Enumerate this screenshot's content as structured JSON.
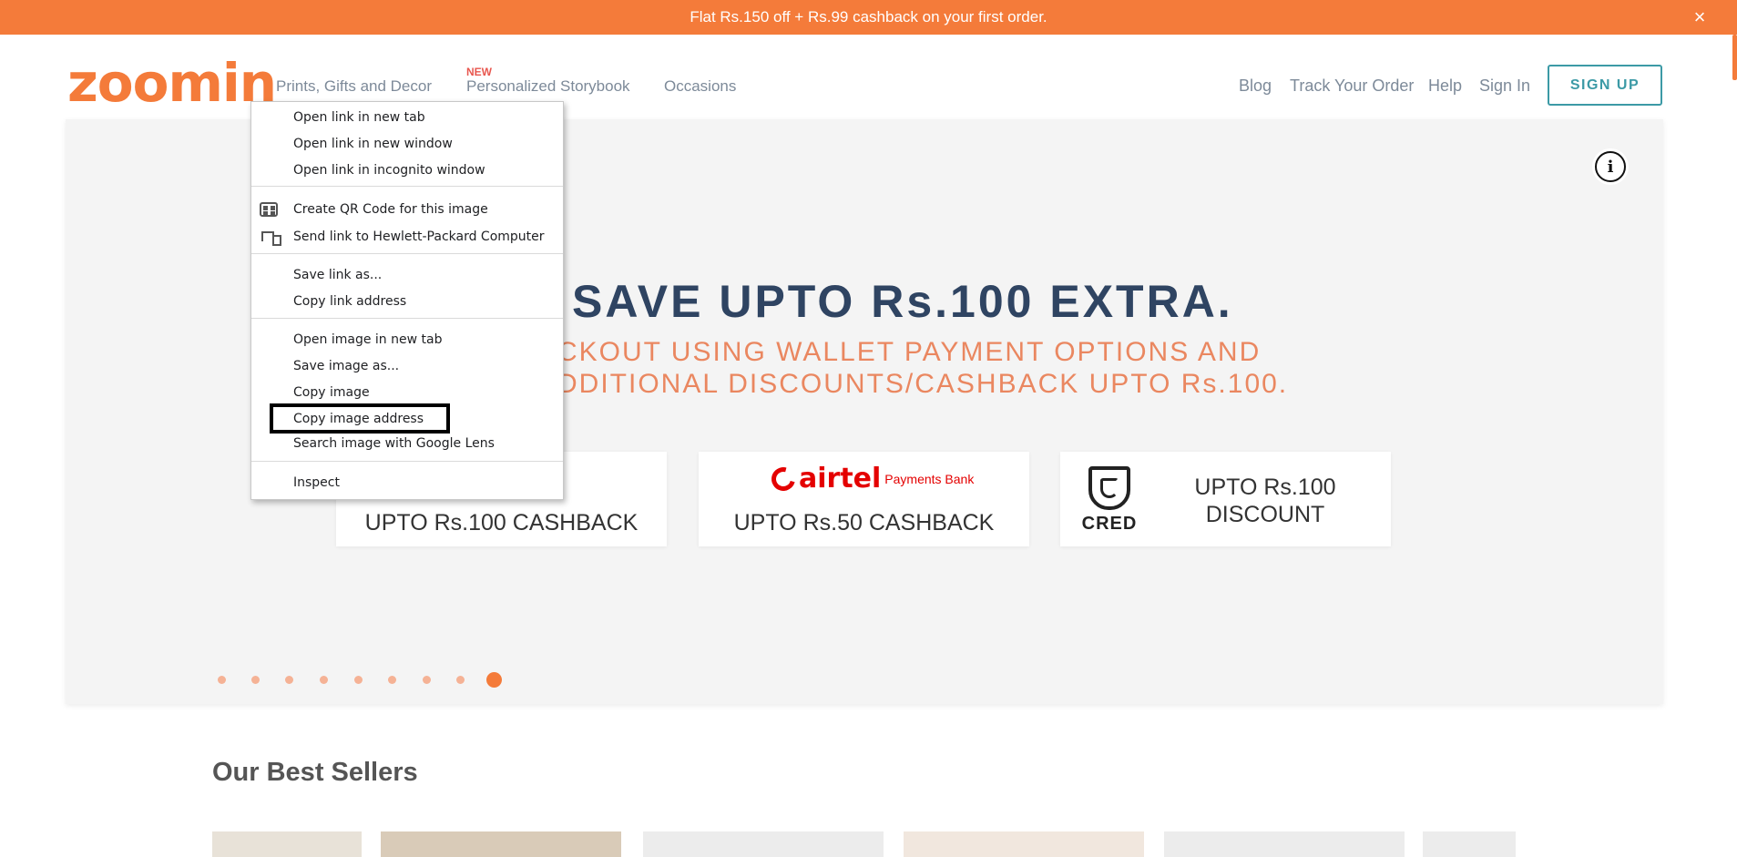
{
  "promo": {
    "text": "Flat Rs.150 off + Rs.99 cashback on your first order.",
    "close_icon": "×"
  },
  "header": {
    "logo": "zoomin",
    "nav": [
      {
        "label": "Prints, Gifts and Decor"
      },
      {
        "label": "Personalized Storybook",
        "badge": "NEW"
      },
      {
        "label": "Occasions"
      }
    ],
    "links": [
      "Blog",
      "Track Your Order",
      "Help",
      "Sign In"
    ],
    "signup_label": "SIGN UP"
  },
  "banner": {
    "info_icon": "i",
    "headline": "SAVE UPTO Rs.100 EXTRA.",
    "sub_line1": "CKOUT USING WALLET PAYMENT OPTIONS AND",
    "sub_line2": "DDITIONAL DISCOUNTS/CASHBACK UPTO Rs.100.",
    "offers": [
      {
        "text": "UPTO Rs.100 CASHBACK"
      },
      {
        "brand": "airtel",
        "brand_sub": "Payments Bank",
        "text": "UPTO Rs.50 CASHBACK"
      },
      {
        "brand": "CRED",
        "text_line1": "UPTO Rs.100",
        "text_line2": "DISCOUNT"
      }
    ],
    "carousel": {
      "slides": 9,
      "active": 9
    }
  },
  "best_sellers": {
    "title": "Our Best Sellers"
  },
  "context_menu": {
    "items": [
      {
        "label": "Open link in new tab"
      },
      {
        "label": "Open link in new window"
      },
      {
        "label": "Open link in incognito window"
      },
      {
        "label": "Create QR Code for this image",
        "icon": "qr-code-icon"
      },
      {
        "label": "Send link to Hewlett-Packard Computer",
        "icon": "device-icon"
      },
      {
        "label": "Save link as..."
      },
      {
        "label": "Copy link address"
      },
      {
        "label": "Open image in new tab"
      },
      {
        "label": "Save image as..."
      },
      {
        "label": "Copy image"
      },
      {
        "label": "Copy image address",
        "highlighted": true
      },
      {
        "label": "Search image with Google Lens"
      },
      {
        "label": "Inspect"
      }
    ]
  },
  "colors": {
    "brand_orange": "#f47b3a",
    "teal": "#3c9aa6",
    "navy": "#2f4462",
    "highlight_box": "#000000"
  }
}
